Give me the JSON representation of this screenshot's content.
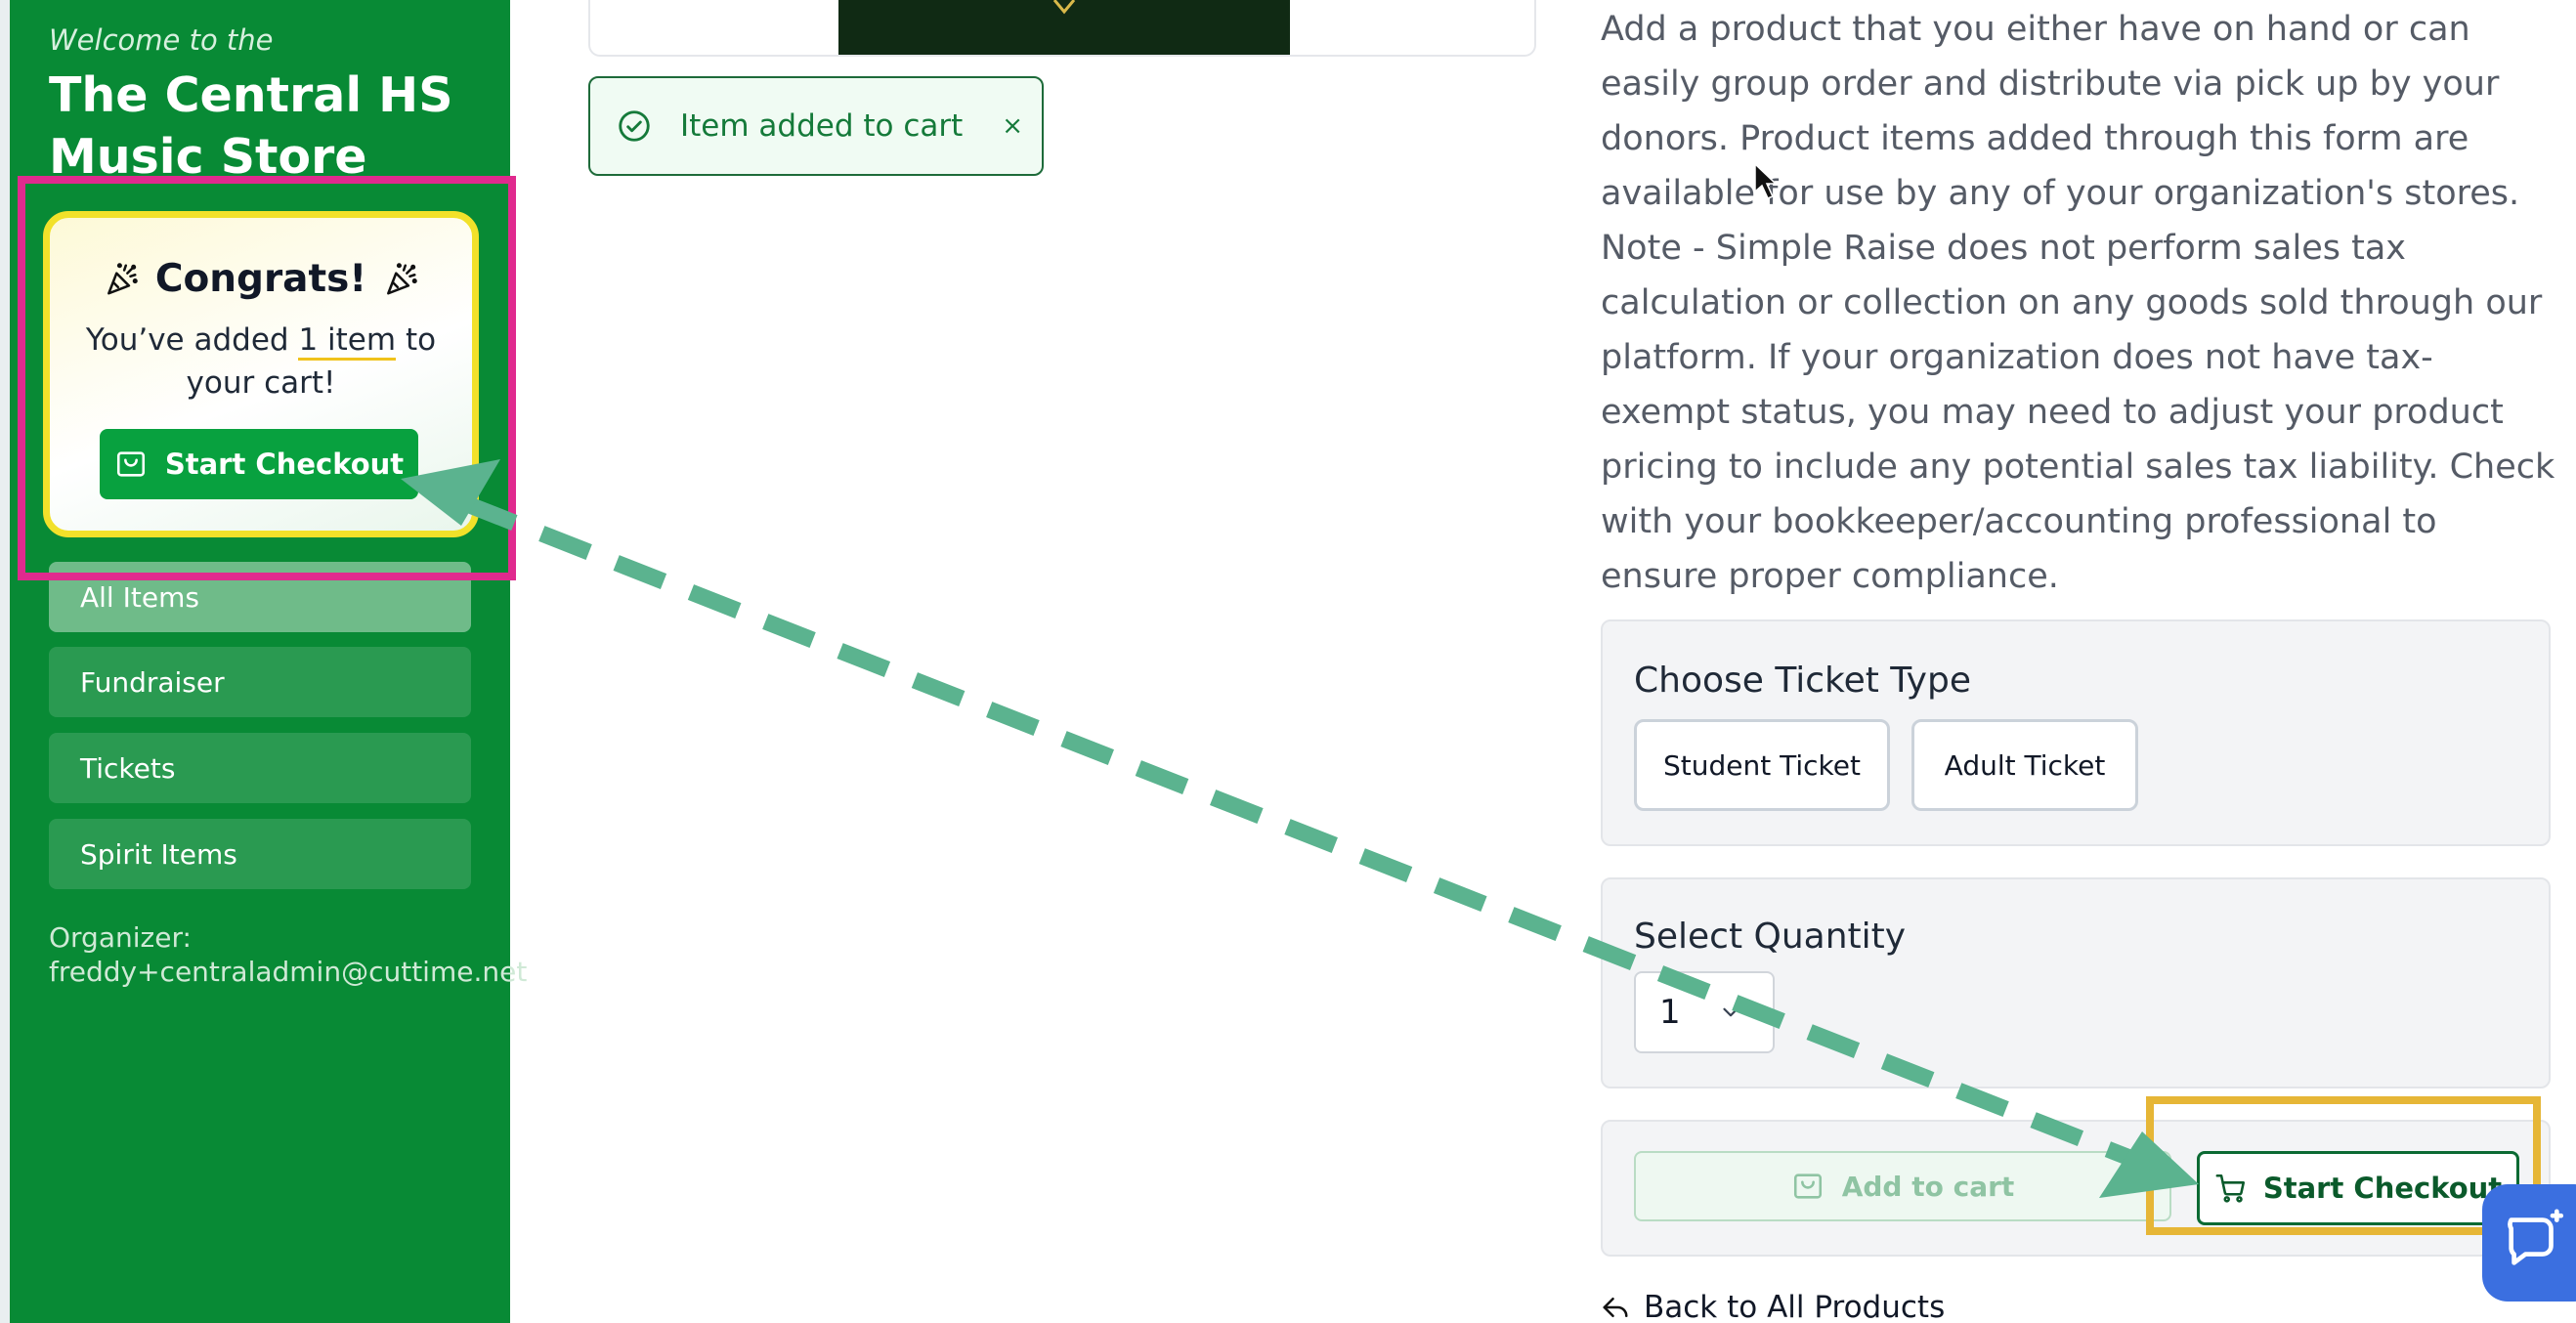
{
  "sidebar": {
    "welcome": "Welcome to the",
    "store_title": "The Central HS Music Store",
    "nav_items": [
      {
        "label": "All Items"
      },
      {
        "label": "Fundraiser"
      },
      {
        "label": "Tickets"
      },
      {
        "label": "Spirit Items"
      }
    ],
    "organizer_label": "Organizer:",
    "organizer_email": "freddy+centraladmin@cuttime.net"
  },
  "congrats_popup": {
    "title": "Congrats!",
    "text_before": "You’ve added",
    "item_count_text": "1 item",
    "text_after": "to your cart!",
    "checkout_label": "Start Checkout"
  },
  "toast": {
    "message": "Item added to cart",
    "close_symbol": "×"
  },
  "product": {
    "description": "Add a product that you either have on hand or can easily group order and distribute via pick up by your donors. Product items added through this form are available for use by any of your organization's stores. Note - Simple Raise does not perform sales tax calculation or collection on any goods sold through our platform. If your organization does not have tax-exempt status, you may need to adjust your product pricing to include any potential sales tax liability. Check with your bookkeeper/accounting professional to ensure proper compliance.",
    "ticket_type_title": "Choose Ticket Type",
    "ticket_types": [
      "Student Ticket",
      "Adult Ticket"
    ],
    "quantity_title": "Select Quantity",
    "quantity_value": "1",
    "add_to_cart_label": "Add to cart",
    "start_checkout_label": "Start Checkout",
    "back_link": "Back to All Products"
  },
  "colors": {
    "sidebar_green": "#088a35",
    "annotation_pink": "#e02a8e",
    "annotation_yellow": "#e6b636",
    "arrow_green": "#5bb38f",
    "chat_blue": "#3b6fe0"
  },
  "icons": [
    "party-popper-icon",
    "cart-icon",
    "check-circle-icon",
    "close-icon",
    "chevron-down-icon",
    "back-arrow-icon",
    "chat-icon",
    "cursor-icon"
  ]
}
